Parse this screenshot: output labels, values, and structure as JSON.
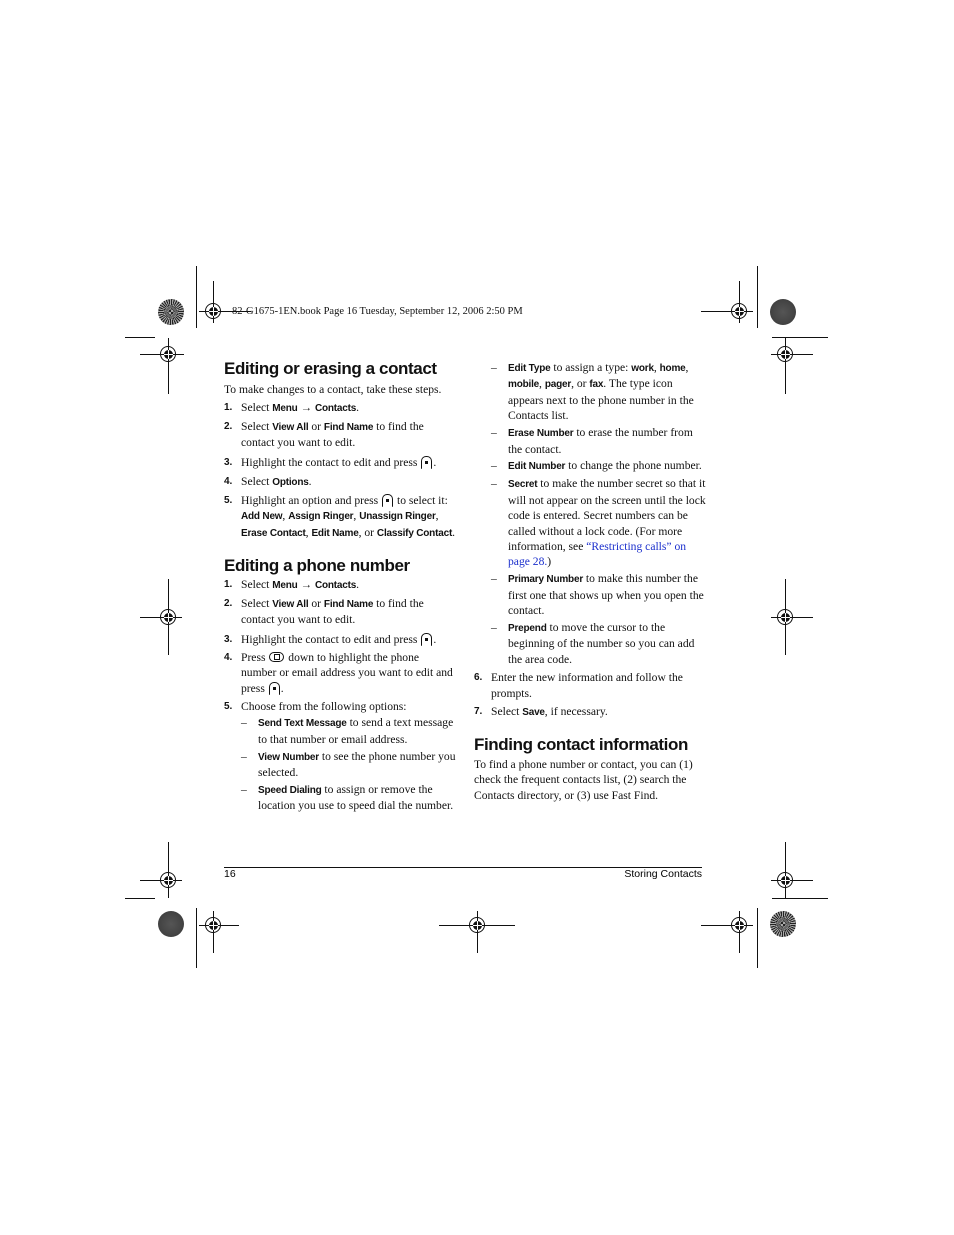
{
  "slug": "82-G1675-1EN.book  Page 16  Tuesday, September 12, 2006  2:50 PM",
  "left_column": {
    "section1": {
      "title": "Editing or erasing a contact",
      "intro": "To make changes to a contact, take these steps.",
      "steps": [
        {
          "num": "1.",
          "t1": "Select ",
          "b1": "Menu",
          "t2": " → ",
          "b2": "Contacts",
          "t3": "."
        },
        {
          "num": "2.",
          "t1": "Select ",
          "b1": "View All",
          "t2": " or ",
          "b2": "Find Name",
          "t3": " to find the contact you want to edit."
        },
        {
          "num": "3.",
          "t1": "Highlight the contact to edit and press ",
          "icon": "ok-key-icon",
          "t2": "."
        },
        {
          "num": "4.",
          "t1": "Select ",
          "b1": "Options",
          "t2": "."
        },
        {
          "num": "5.",
          "t1": "Highlight an option and press ",
          "icon": "ok-key-icon",
          "t2": " to select it: ",
          "b1": "Add New",
          "t3": ", ",
          "b2": "Assign Ringer",
          "t4": ", ",
          "b3": "Unassign Ringer",
          "t5": ", ",
          "b4": "Erase Contact",
          "t6": ", ",
          "b5": "Edit Name",
          "t7": ", or ",
          "b6": "Classify Contact",
          "t8": "."
        }
      ]
    },
    "section2": {
      "title": "Editing a phone number",
      "steps": [
        {
          "num": "1.",
          "t1": "Select ",
          "b1": "Menu",
          "t2": " → ",
          "b2": "Contacts",
          "t3": "."
        },
        {
          "num": "2.",
          "t1": "Select ",
          "b1": "View All",
          "t2": " or ",
          "b2": "Find Name",
          "t3": " to find the contact you want to edit."
        },
        {
          "num": "3.",
          "t1": "Highlight the contact to edit and press ",
          "icon": "ok-key-icon",
          "t2": "."
        },
        {
          "num": "4.",
          "t1": "Press ",
          "icon": "navigation-key-icon",
          "t2": " down to highlight the phone number or email address you want to edit and press ",
          "icon2": "ok-key-icon",
          "t3": "."
        },
        {
          "num": "5.",
          "t1": "Choose from the following options:"
        }
      ],
      "options_left": [
        {
          "label": "Send Text Message",
          "desc": " to send a text message to that number or email address."
        },
        {
          "label": "View Number",
          "desc": " to see the phone number you selected."
        },
        {
          "label": "Speed Dialing",
          "desc": " to assign or remove the location you use to speed dial the number."
        }
      ]
    }
  },
  "right_column": {
    "options_right": [
      {
        "label": "Edit Type",
        "desc1": " to assign a type: ",
        "b1": "work",
        "s1": ", ",
        "b2": "home",
        "s2": ", ",
        "b3": "mobile",
        "s3": ", ",
        "b4": "pager",
        "s4": ", or ",
        "b5": "fax",
        "desc2": ". The type icon appears next to the phone number in the Contacts list."
      },
      {
        "label": "Erase Number",
        "desc": " to erase the number from the contact."
      },
      {
        "label": "Edit Number",
        "desc": " to change the phone number."
      },
      {
        "label": "Secret",
        "desc": " to make the number secret so that it will not appear on the screen until the lock code is entered. Secret numbers can be called without a lock code. (For more information, see ",
        "link": "“Restricting calls” on page 28.",
        "after": ")"
      },
      {
        "label": "Primary Number",
        "desc": " to make this number the first one that shows up when you open the contact."
      },
      {
        "label": "Prepend",
        "desc": " to move the cursor to the beginning of the number so you can add the area code."
      }
    ],
    "steps": [
      {
        "num": "6.",
        "t1": "Enter the new information and follow the prompts."
      },
      {
        "num": "7.",
        "t1": "Select ",
        "b1": "Save",
        "t2": ", if necessary."
      }
    ],
    "section3": {
      "title": "Finding contact information",
      "body": "To find a phone number or contact, you can (1) check the frequent contacts list, (2) search the Contacts directory, or (3) use Fast Find."
    }
  },
  "footer": {
    "page_number": "16",
    "chapter": "Storing Contacts"
  },
  "colors": {
    "link": "#1a2ecc",
    "text": "#111111"
  }
}
